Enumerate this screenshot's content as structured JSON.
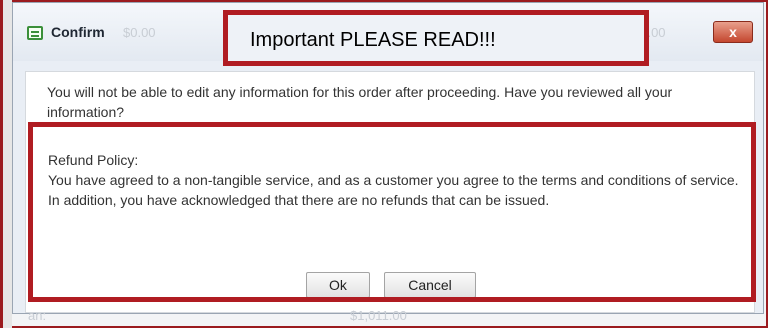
{
  "dialog": {
    "title": "Confirm",
    "ghost_left": "$0.00",
    "ghost_right": "$0.00",
    "close_symbol": "x",
    "message": "You will not be able to edit any information for this order after proceeding. Have you reviewed all your information?",
    "policy_heading": "Refund Policy:",
    "policy_body": "You have agreed to a non-tangible service, and as a customer you agree to the terms and conditions of service. In addition, you have acknowledged that there are no refunds that can be issued.",
    "ok_label": "Ok",
    "cancel_label": "Cancel"
  },
  "annotation": {
    "important_label": "Important PLEASE READ!!!",
    "color": "#b01c22"
  },
  "background": {
    "bottom_left_text": "an:",
    "bottom_center_text": "$1,011.00"
  },
  "icons": {
    "title_icon": "form-icon",
    "close_icon": "close-icon"
  }
}
